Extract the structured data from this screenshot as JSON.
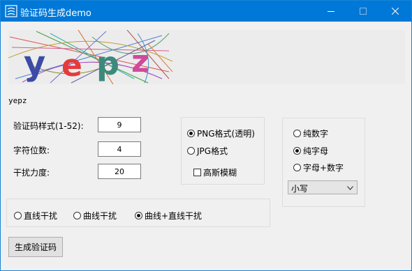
{
  "window": {
    "title": "验证码生成demo"
  },
  "captcha": {
    "code": "yepz",
    "letters": [
      "y",
      "e",
      "p",
      "z"
    ],
    "letter_colors": [
      "#3d4aa6",
      "#e53a3a",
      "#3b8a7a",
      "#d04a9a"
    ]
  },
  "settings": {
    "style_label": "验证码样式(1-52):",
    "style_value": "9",
    "digits_label": "字符位数:",
    "digits_value": "4",
    "noise_label": "干扰力度:",
    "noise_value": "20"
  },
  "format": {
    "png_label": "PNG格式(透明)",
    "png_selected": true,
    "jpg_label": "JPG格式",
    "jpg_selected": false,
    "blur_label": "高斯模糊",
    "blur_checked": false
  },
  "char_type": {
    "digits_label": "纯数字",
    "digits_selected": false,
    "letters_label": "纯字母",
    "letters_selected": true,
    "mixed_label": "字母+数字",
    "mixed_selected": false,
    "case_value": "小写"
  },
  "noise_type": {
    "line_label": "直线干扰",
    "line_selected": false,
    "curve_label": "曲线干扰",
    "curve_selected": false,
    "both_label": "曲线+直线干扰",
    "both_selected": true
  },
  "actions": {
    "generate_label": "生成验证码"
  },
  "colors": {
    "titlebar": "#0078d7",
    "window_bg": "#f0f0f0"
  }
}
